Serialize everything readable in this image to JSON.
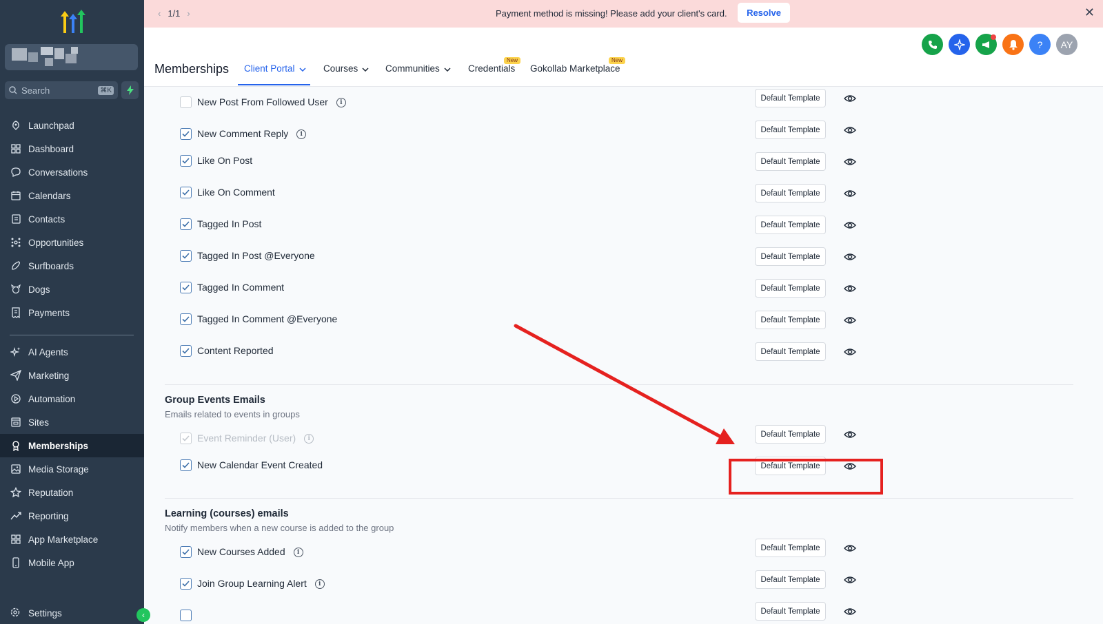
{
  "sidebar": {
    "search": {
      "placeholder": "Search",
      "shortcut": "⌘K"
    },
    "items": [
      {
        "label": "Launchpad",
        "icon": "rocket-icon"
      },
      {
        "label": "Dashboard",
        "icon": "grid-icon"
      },
      {
        "label": "Conversations",
        "icon": "chat-bubble-icon"
      },
      {
        "label": "Calendars",
        "icon": "calendar-icon"
      },
      {
        "label": "Contacts",
        "icon": "contact-card-icon"
      },
      {
        "label": "Opportunities",
        "icon": "network-icon"
      },
      {
        "label": "Surfboards",
        "icon": "surfboard-icon"
      },
      {
        "label": "Dogs",
        "icon": "dog-icon"
      },
      {
        "label": "Payments",
        "icon": "receipt-icon"
      }
    ],
    "items2": [
      {
        "label": "AI Agents",
        "icon": "sparkle-icon"
      },
      {
        "label": "Marketing",
        "icon": "send-icon"
      },
      {
        "label": "Automation",
        "icon": "play-circle-icon"
      },
      {
        "label": "Sites",
        "icon": "browser-icon"
      },
      {
        "label": "Memberships",
        "icon": "award-icon",
        "active": true
      },
      {
        "label": "Media Storage",
        "icon": "image-icon"
      },
      {
        "label": "Reputation",
        "icon": "star-icon"
      },
      {
        "label": "Reporting",
        "icon": "trend-icon"
      },
      {
        "label": "App Marketplace",
        "icon": "apps-icon"
      },
      {
        "label": "Mobile App",
        "icon": "phone-icon"
      }
    ],
    "settings": "Settings"
  },
  "banner": {
    "page": "1/1",
    "message": "Payment method is missing! Please add your client's card.",
    "action": "Resolve"
  },
  "header": {
    "title": "Memberships",
    "tabs": [
      {
        "label": "Client Portal",
        "dropdown": true,
        "active": true
      },
      {
        "label": "Courses",
        "dropdown": true
      },
      {
        "label": "Communities",
        "dropdown": true
      },
      {
        "label": "Credentials",
        "badge": "New"
      },
      {
        "label": "Gokollab Marketplace",
        "badge": "New"
      }
    ],
    "avatar": "AY",
    "colors": {
      "phone": "#16a34a",
      "ai": "#2563eb",
      "announce": "#16a34a",
      "notify": "#f97316",
      "help": "#3b82f6",
      "avatar": "#9ca3af"
    }
  },
  "content": {
    "template_label": "Default Template",
    "rows_top": [
      {
        "label": "New Post From Followed User",
        "checked": false,
        "info": true
      },
      {
        "label": "New Comment Reply",
        "checked": true,
        "info": true
      },
      {
        "label": "Like On Post",
        "checked": true,
        "info": false
      },
      {
        "label": "Like On Comment",
        "checked": true,
        "info": false
      },
      {
        "label": "Tagged In Post",
        "checked": true,
        "info": false
      },
      {
        "label": "Tagged In Post @Everyone",
        "checked": true,
        "info": false
      },
      {
        "label": "Tagged In Comment",
        "checked": true,
        "info": false
      },
      {
        "label": "Tagged In Comment @Everyone",
        "checked": true,
        "info": false
      },
      {
        "label": "Content Reported",
        "checked": true,
        "info": false
      }
    ],
    "group_events": {
      "title": "Group Events Emails",
      "subtitle": "Emails related to events in groups",
      "rows": [
        {
          "label": "Event Reminder (User)",
          "checked": true,
          "disabled": true,
          "info": true
        },
        {
          "label": "New Calendar Event Created",
          "checked": true,
          "info": false
        }
      ]
    },
    "learning": {
      "title": "Learning (courses) emails",
      "subtitle": "Notify members when a new course is added to the group",
      "rows": [
        {
          "label": "New Courses Added",
          "checked": true,
          "info": true
        },
        {
          "label": "Join Group Learning Alert",
          "checked": true,
          "info": true
        }
      ]
    }
  },
  "annotation_color": "#e5211f"
}
